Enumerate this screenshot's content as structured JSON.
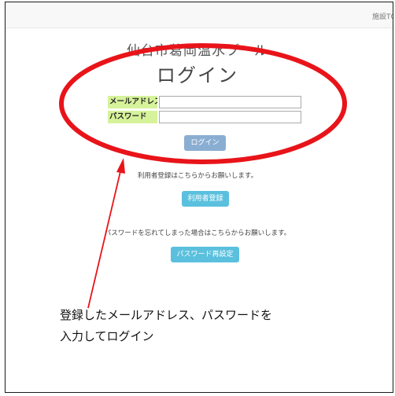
{
  "topbar": {
    "link_label": "施設TOP"
  },
  "header": {
    "facility_name": "仙台市葛岡温水プール",
    "title": "ログイン"
  },
  "login_form": {
    "email_label": "メールアドレス",
    "email_value": "",
    "password_label": "パスワード",
    "password_value": "",
    "submit_label": "ログイン"
  },
  "register": {
    "text": "利用者登録はこちらからお願いします。",
    "button_label": "利用者登録"
  },
  "password_reset": {
    "text": "パスワードを忘れてしまった場合はこちらからお願いします。",
    "button_label": "パスワード再設定"
  },
  "annotation": {
    "line1": "登録したメールアドレス、パスワードを",
    "line2": "入力してログイン",
    "color": "#e8141a"
  },
  "colors": {
    "label_bg": "#d6f29a",
    "login_button": "#8aaed2",
    "info_button": "#5bc0de"
  }
}
